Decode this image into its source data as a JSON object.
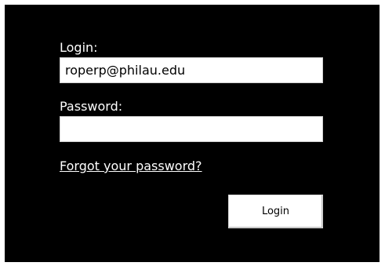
{
  "form": {
    "login_label": "Login:",
    "login_value": "roperp@philau.edu",
    "password_label": "Password:",
    "password_value": "",
    "forgot_link": "Forgot your password?",
    "submit_label": "Login"
  },
  "colors": {
    "panel_background": "#000000",
    "label_text": "#ffffff",
    "field_background": "#ffffff"
  }
}
